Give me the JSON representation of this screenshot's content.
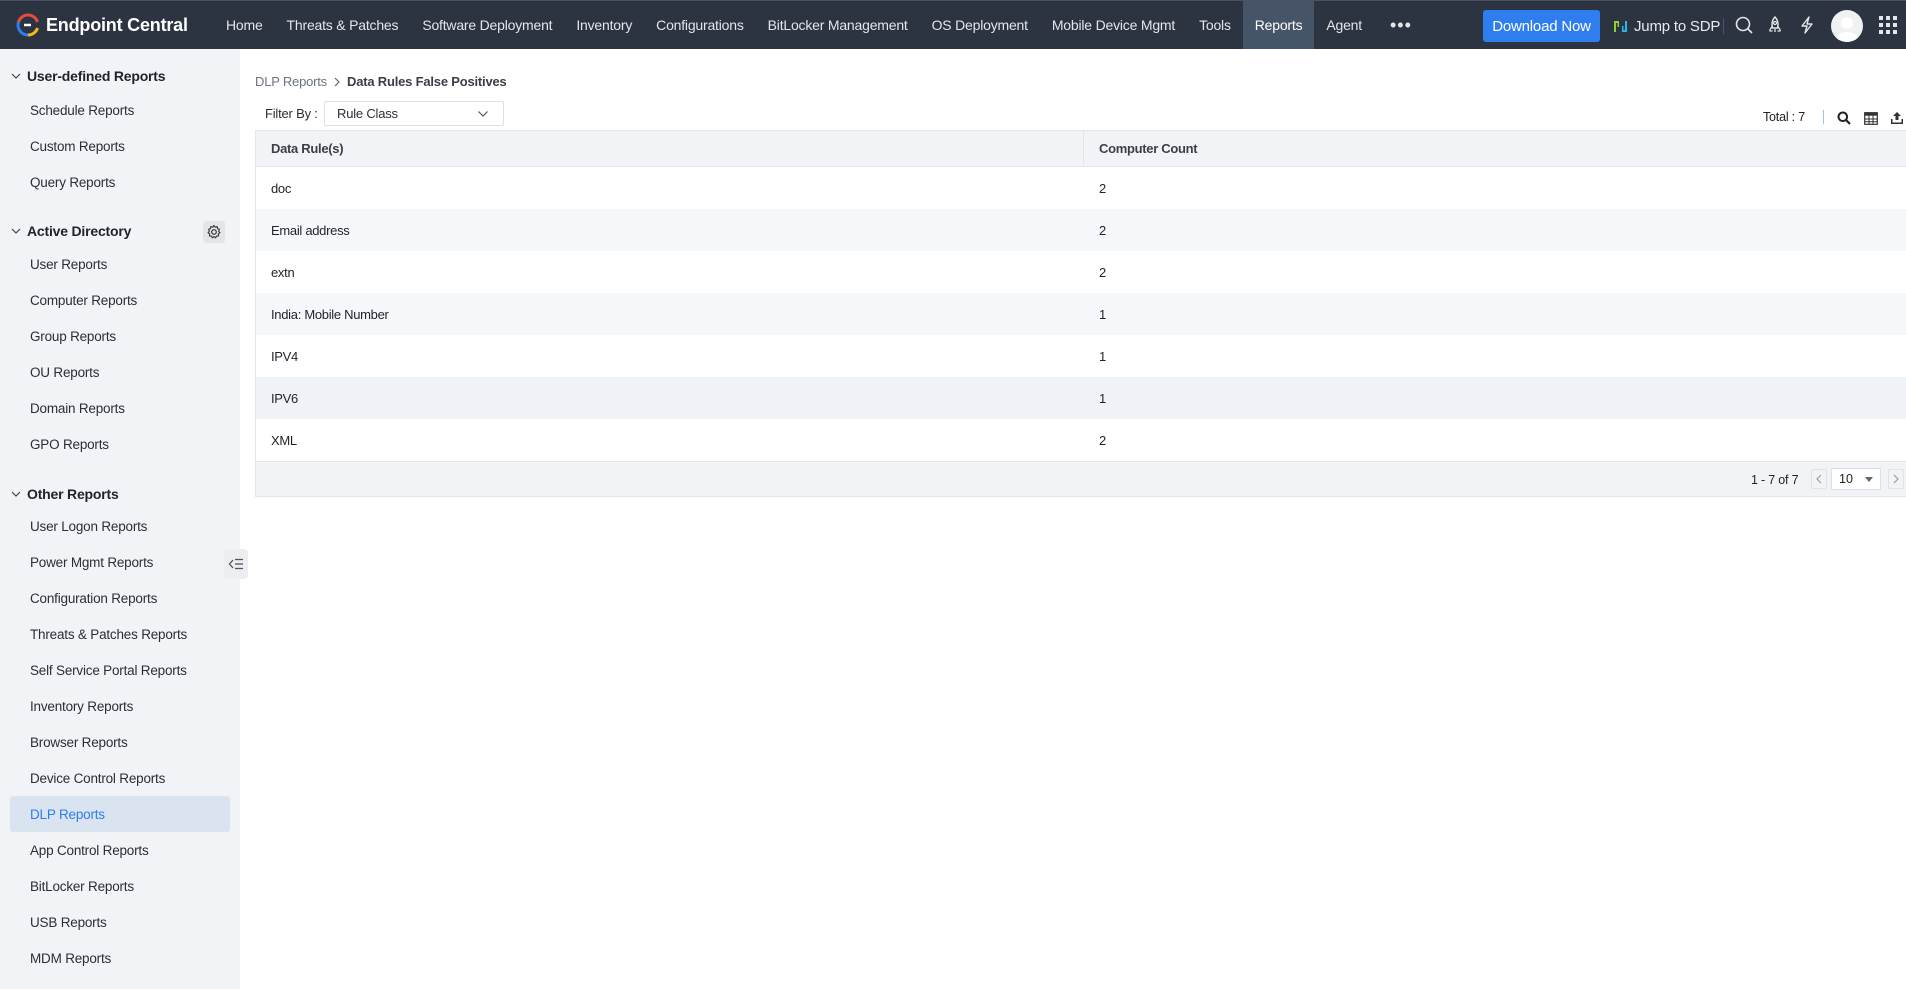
{
  "app": {
    "name": "Endpoint Central"
  },
  "topnav": {
    "items": [
      {
        "label": "Home",
        "active": false
      },
      {
        "label": "Threats & Patches",
        "active": false
      },
      {
        "label": "Software Deployment",
        "active": false
      },
      {
        "label": "Inventory",
        "active": false
      },
      {
        "label": "Configurations",
        "active": false
      },
      {
        "label": "BitLocker Management",
        "active": false
      },
      {
        "label": "OS Deployment",
        "active": false
      },
      {
        "label": "Mobile Device Mgmt",
        "active": false
      },
      {
        "label": "Tools",
        "active": false
      },
      {
        "label": "Reports",
        "active": true
      },
      {
        "label": "Agent",
        "active": false
      }
    ],
    "more_label": "•••",
    "download_button": "Download Now",
    "jump_label": "Jump to SDP",
    "icons": [
      "search-icon",
      "rocket-icon",
      "lightning-icon",
      "avatar",
      "app-grid-icon"
    ]
  },
  "sidebar": {
    "sections": [
      {
        "title": "User-defined Reports",
        "items": [
          "Schedule Reports",
          "Custom Reports",
          "Query Reports"
        ]
      },
      {
        "title": "Active Directory",
        "items": [
          "User Reports",
          "Computer Reports",
          "Group Reports",
          "OU Reports",
          "Domain Reports",
          "GPO Reports"
        ]
      },
      {
        "title": "Other Reports",
        "items": [
          "User Logon Reports",
          "Power Mgmt Reports",
          "Configuration Reports",
          "Threats & Patches Reports",
          "Self Service Portal Reports",
          "Inventory Reports",
          "Browser Reports",
          "Device Control Reports",
          "DLP Reports",
          "App Control Reports",
          "BitLocker Reports",
          "USB Reports",
          "MDM Reports"
        ]
      }
    ],
    "active_item": "DLP Reports"
  },
  "main": {
    "breadcrumb": {
      "parent": "DLP Reports",
      "current": "Data Rules False Positives"
    },
    "filter": {
      "label": "Filter By :",
      "selected": "Rule Class"
    },
    "total_label": "Total : 7",
    "table": {
      "columns": [
        "Data Rule(s)",
        "Computer Count"
      ],
      "rows": [
        {
          "rule": "doc",
          "count": "2"
        },
        {
          "rule": "Email address",
          "count": "2"
        },
        {
          "rule": "extn",
          "count": "2"
        },
        {
          "rule": "India: Mobile Number",
          "count": "1"
        },
        {
          "rule": "IPV4",
          "count": "1"
        },
        {
          "rule": "IPV6",
          "count": "1"
        },
        {
          "rule": "XML",
          "count": "2"
        }
      ]
    },
    "pagination": {
      "range": "1 - 7 of 7",
      "page_size": "10"
    }
  },
  "colors": {
    "topbar": "#2c3442",
    "accent": "#2f7ef0",
    "sidebar_bg": "#f2f3f6",
    "active_item_bg": "#d9e4f0"
  }
}
